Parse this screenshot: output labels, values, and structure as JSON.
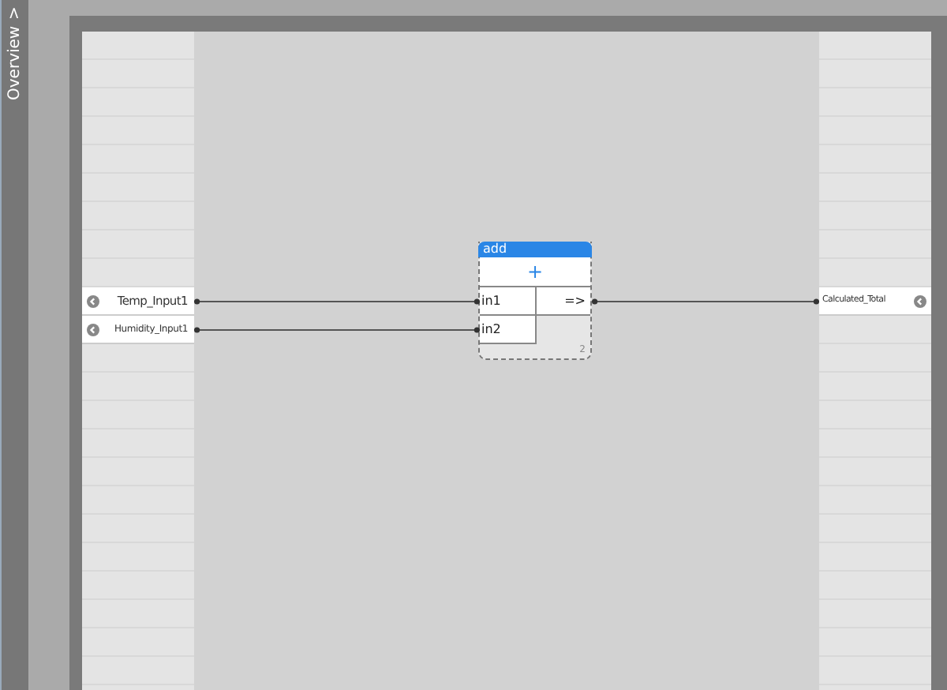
{
  "sidebar": {
    "label": "Overview",
    "toggle": ">"
  },
  "inputs": [
    {
      "name": "Temp_Input1"
    },
    {
      "name": "Humidity_Input1"
    }
  ],
  "node": {
    "title": "add",
    "operator": "+",
    "ports": [
      "in1",
      "in2"
    ],
    "output": "=>",
    "count": "2"
  },
  "outputs": [
    {
      "name": "Calculated_Total"
    }
  ]
}
